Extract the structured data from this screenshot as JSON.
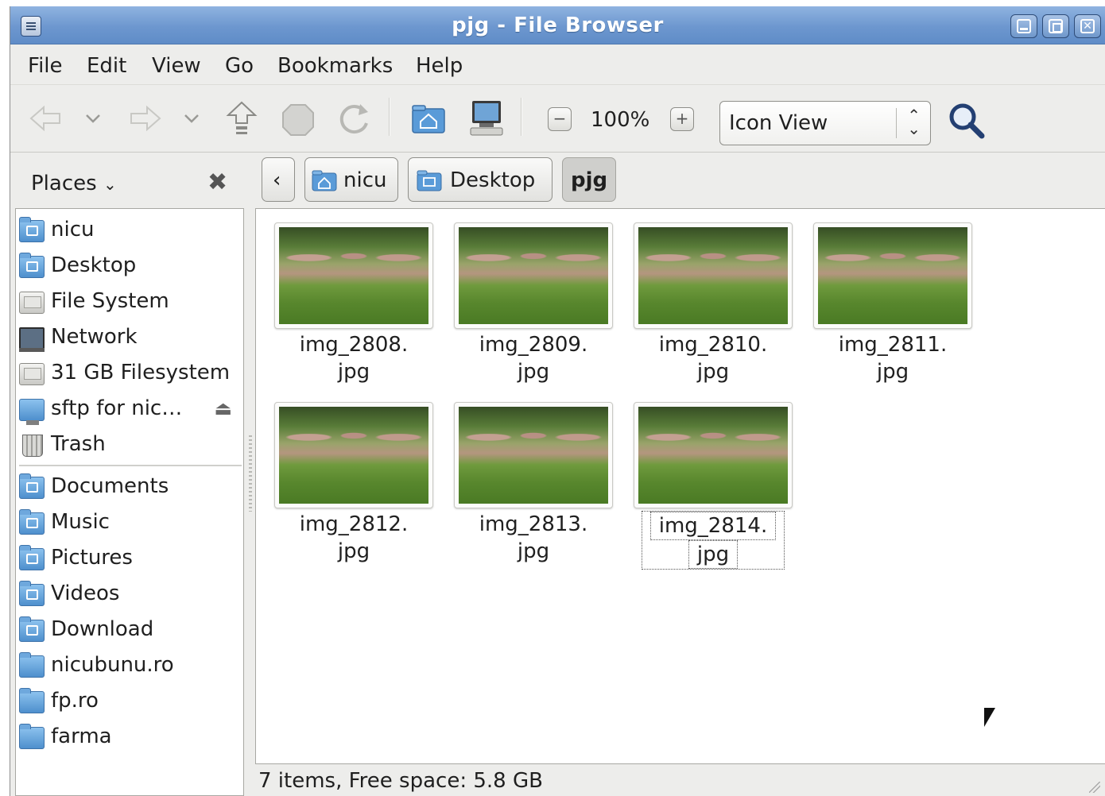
{
  "window": {
    "title": "pjg - File Browser"
  },
  "menubar": {
    "items": [
      "File",
      "Edit",
      "View",
      "Go",
      "Bookmarks",
      "Help"
    ]
  },
  "toolbar": {
    "zoom_level": "100%",
    "view_mode": "Icon View",
    "icons": [
      "back-icon",
      "chevron-down-icon",
      "forward-icon",
      "chevron-down-icon",
      "up-icon",
      "stop-icon",
      "reload-icon",
      "home-folder-icon",
      "computer-icon",
      "zoom-out-icon",
      "zoom-in-icon",
      "search-icon"
    ]
  },
  "places": {
    "label": "Places",
    "items": [
      {
        "label": "nicu",
        "icon": "home-folder-icon"
      },
      {
        "label": "Desktop",
        "icon": "desktop-folder-icon"
      },
      {
        "label": "File System",
        "icon": "drive-icon"
      },
      {
        "label": "Network",
        "icon": "network-icon"
      },
      {
        "label": "31 GB Filesystem",
        "icon": "drive-icon"
      },
      {
        "label": "sftp for nic…",
        "icon": "network-share-icon"
      },
      {
        "label": "Trash",
        "icon": "trash-icon"
      }
    ],
    "bookmarks": [
      {
        "label": "Documents",
        "icon": "documents-folder-icon"
      },
      {
        "label": "Music",
        "icon": "music-folder-icon"
      },
      {
        "label": "Pictures",
        "icon": "pictures-folder-icon"
      },
      {
        "label": "Videos",
        "icon": "videos-folder-icon"
      },
      {
        "label": "Download",
        "icon": "download-folder-icon"
      },
      {
        "label": "nicubunu.ro",
        "icon": "folder-icon"
      },
      {
        "label": "fp.ro",
        "icon": "folder-icon"
      },
      {
        "label": "farma",
        "icon": "folder-icon"
      }
    ]
  },
  "pathbar": {
    "segments": [
      {
        "label": "nicu"
      },
      {
        "label": "Desktop"
      },
      {
        "label": "pjg"
      }
    ]
  },
  "files": [
    {
      "name_line1": "img_2808.",
      "name_line2": "jpg"
    },
    {
      "name_line1": "img_2809.",
      "name_line2": "jpg"
    },
    {
      "name_line1": "img_2810.",
      "name_line2": "jpg"
    },
    {
      "name_line1": "img_2811.",
      "name_line2": "jpg"
    },
    {
      "name_line1": "img_2812.",
      "name_line2": "jpg"
    },
    {
      "name_line1": "img_2813.",
      "name_line2": "jpg"
    },
    {
      "name_line1": "img_2814.",
      "name_line2": "jpg"
    }
  ],
  "status": {
    "text": "7 items, Free space: 5.8 GB"
  },
  "colors": {
    "titlebar": "#6d97cf",
    "folder": "#4e8fcd",
    "background": "#ededeb"
  }
}
